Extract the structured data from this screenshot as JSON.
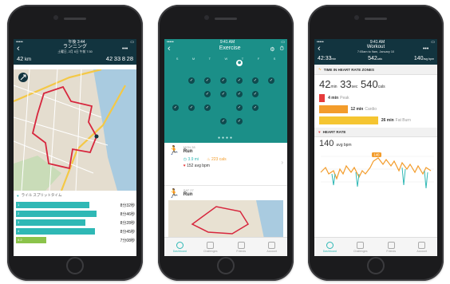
{
  "colors": {
    "teal": "#2fb8b5",
    "navy": "#12343f",
    "green": "#1b8f88",
    "red": "#e63b3b",
    "orange": "#f39c2b",
    "yellow": "#f5c531"
  },
  "phone1": {
    "status_time": "午後 3:44",
    "title": "ランニング",
    "subtitle": "土曜日, 2月 6日 午前 7:30",
    "stats": {
      "distance": "42",
      "distance_unit": "km",
      "duration_a": "42",
      "duration_b": "33",
      "duration_c": "8",
      "duration_d": "28"
    },
    "splits_title": "ライル スプリットタイム",
    "splits": [
      {
        "label": "1",
        "time": "8分32秒",
        "fill": 0.78
      },
      {
        "label": "2",
        "time": "8分46秒",
        "fill": 0.86
      },
      {
        "label": "3",
        "time": "8分28秒",
        "fill": 0.74
      },
      {
        "label": "4",
        "time": "8分45秒",
        "fill": 0.84
      },
      {
        "label": "4.2",
        "time": "7分08秒",
        "fill": 0.32
      }
    ]
  },
  "phone2": {
    "status_time": "9:41 AM",
    "title": "Exercise",
    "weekdays": [
      "S",
      "M",
      "T",
      "W",
      "T",
      "F",
      "S"
    ],
    "card1": {
      "date": "MON 28",
      "activity": "Run",
      "distance": "3.9 mi",
      "calories": "223 cals",
      "heart": "152 avg bpm"
    },
    "card2": {
      "date": "SAT 27",
      "activity": "Run"
    },
    "tabs": [
      "Dashboard",
      "Challenges",
      "Friends",
      "Account"
    ]
  },
  "phone3": {
    "status_time": "9:41 AM",
    "title": "Workout",
    "subtitle": "7:05am to 9am, January 10",
    "stats": {
      "duration": "42:33",
      "duration_unit": "min",
      "calories": "542",
      "calories_unit": "cals",
      "bpm": "140",
      "bpm_unit": "avg bpm"
    },
    "zones_title": "TIME IN HEART RATE ZONES",
    "big": {
      "min": "42",
      "min_unit": "min",
      "sec": "33",
      "sec_unit": "sec",
      "cals": "540",
      "cals_unit": "cals"
    },
    "zones": [
      {
        "value": "4 min",
        "name": "Peak",
        "fill": 0.05
      },
      {
        "value": "12 min",
        "name": "Cardio",
        "fill": 0.25
      },
      {
        "value": "26 min",
        "name": "Fat Burn",
        "fill": 0.52
      }
    ],
    "hr_title": "HEART RATE",
    "hr_value": "140",
    "hr_unit": "avg bpm",
    "hr_badge": "140",
    "tabs": [
      "Dashboard",
      "Challenges",
      "Friends",
      "Account"
    ]
  }
}
